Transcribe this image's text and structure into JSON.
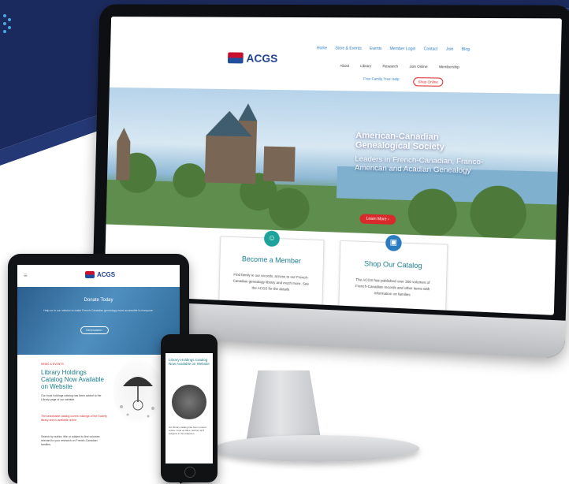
{
  "colors": {
    "brand_navy": "#1b2a5e",
    "brand_red": "#d9292b",
    "teal": "#1b7c8a",
    "link_blue": "#2a7bbf"
  },
  "desktop": {
    "logo_text": "ACGS",
    "top_nav": [
      "Home",
      "Store & Events",
      "Events",
      "Member Login",
      "Contact",
      "Join",
      "Blog"
    ],
    "sub_nav": [
      "About",
      "Library",
      "Research",
      "Join Online",
      "Membership"
    ],
    "header_link": "Free Family Tree Help",
    "header_button": "Shop Online",
    "hero": {
      "title": "American-Canadian Genealogical Society",
      "subtitle": "Leaders in French-Canadian, Franco-American and Acadian Genealogy",
      "button": "Learn More ›"
    },
    "cards": [
      {
        "icon": "person-icon",
        "title": "Become a Member",
        "text": "Find family in our records, access to our French-Canadian genealogy library and much more. See the ACGS for the details"
      },
      {
        "icon": "cart-icon",
        "title": "Shop Our Catalog",
        "text": "The ACGS has published over 300 volumes of French-Canadian records and other items with information on families"
      }
    ]
  },
  "tablet": {
    "logo_text": "ACGS",
    "hero_title": "Donate Today",
    "hero_text": "Help us in our mission to make French-Canadian genealogy more accessible to everyone.",
    "hero_button": "Get involved ›",
    "kicker": "NEWS & EVENTS",
    "article_title": "Library Holdings Catalog Now Available on Website",
    "paragraphs": [
      "Our book holdings catalog has been added to the Library page of our website.",
      "The searchable catalog covers holdings of the Society library and is available online.",
      "Search by author, title or subject to find volumes relevant to your research on French-Canadian families."
    ]
  },
  "phone": {
    "article_title": "Library Holdings Catalog Now Available on Website",
    "text": "Our library catalog has been posted online. Look up titles, authors and subjects in the collection."
  }
}
